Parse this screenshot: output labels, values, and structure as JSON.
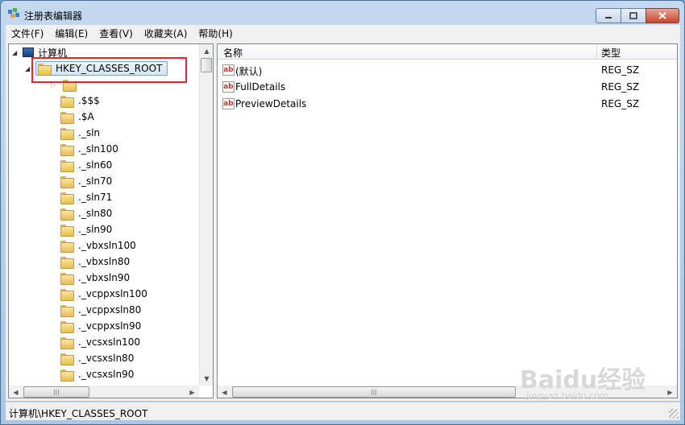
{
  "window": {
    "title": "注册表编辑器"
  },
  "menu": [
    "文件(F)",
    "编辑(E)",
    "查看(V)",
    "收藏夹(A)",
    "帮助(H)"
  ],
  "tree": {
    "computer_label": "计算机",
    "root_label": "HKEY_CLASSES_ROOT",
    "children": [
      ".$$$",
      ".$A",
      "._sln",
      "._sln100",
      "._sln60",
      "._sln70",
      "._sln71",
      "._sln80",
      "._sln90",
      "._vbxsln100",
      "._vbxsln80",
      "._vbxsln90",
      "._vcppxsln100",
      "._vcppxsln80",
      "._vcppxsln90",
      "._vcsxsln100",
      "._vcsxsln80",
      "._vcsxsln90"
    ]
  },
  "list": {
    "columns": {
      "name": "名称",
      "type": "类型"
    },
    "rows": [
      {
        "name": "(默认)",
        "type": "REG_SZ"
      },
      {
        "name": "FullDetails",
        "type": "REG_SZ"
      },
      {
        "name": "PreviewDetails",
        "type": "REG_SZ"
      }
    ]
  },
  "status": {
    "path": "计算机\\HKEY_CLASSES_ROOT"
  },
  "watermark": {
    "logo": "Baidu经验",
    "url": "jingyan.baidu.com"
  }
}
